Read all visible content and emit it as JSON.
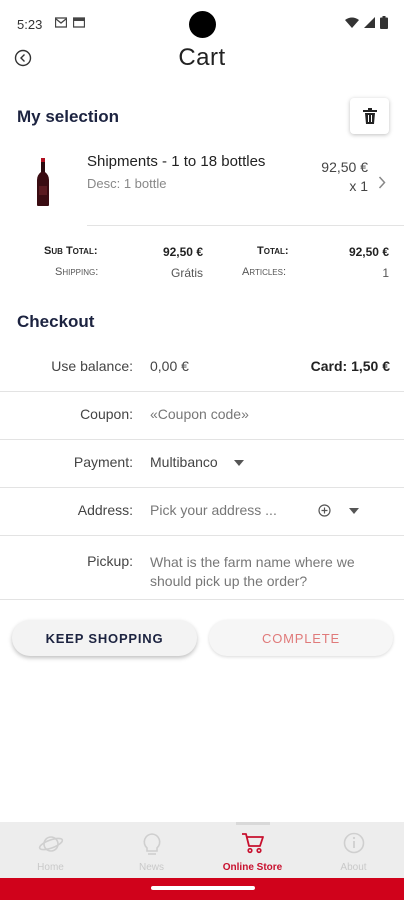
{
  "status": {
    "time": "5:23"
  },
  "header": {
    "title": "Cart"
  },
  "selection": {
    "title": "My selection"
  },
  "product": {
    "name": "Shipments - 1 to 18 bottles",
    "desc": "Desc: 1 bottle",
    "price": "92,50 €",
    "qty": "x 1"
  },
  "totals": {
    "subtotal_label": "Sub Total:",
    "subtotal_value": "92,50 €",
    "total_label": "Total:",
    "total_value": "92,50 €",
    "shipping_label": "Shipping:",
    "shipping_value": "Grátis",
    "articles_label": "Articles:",
    "articles_value": "1"
  },
  "checkout": {
    "title": "Checkout",
    "balance_label": "Use balance:",
    "balance_value": "0,00 €",
    "card_value": "Card: 1,50 €",
    "coupon_label": "Coupon:",
    "coupon_placeholder": "«Coupon code»",
    "payment_label": "Payment:",
    "payment_value": "Multibanco",
    "address_label": "Address:",
    "address_value": "Pick your address ...",
    "pickup_label": "Pickup:",
    "pickup_value": "What is the farm name where we should pick up the order?"
  },
  "buttons": {
    "keep_shopping": "KEEP SHOPPING",
    "complete": "COMPLETE"
  },
  "nav": [
    {
      "label": "Home",
      "icon": "planet-icon"
    },
    {
      "label": "News",
      "icon": "lightbulb-icon"
    },
    {
      "label": "Online Store",
      "icon": "cart-icon",
      "active": true
    },
    {
      "label": "About",
      "icon": "info-icon"
    }
  ],
  "colors": {
    "brand_red": "#d0021b",
    "navy": "#1c2340",
    "complete_text": "#e07a7a"
  }
}
